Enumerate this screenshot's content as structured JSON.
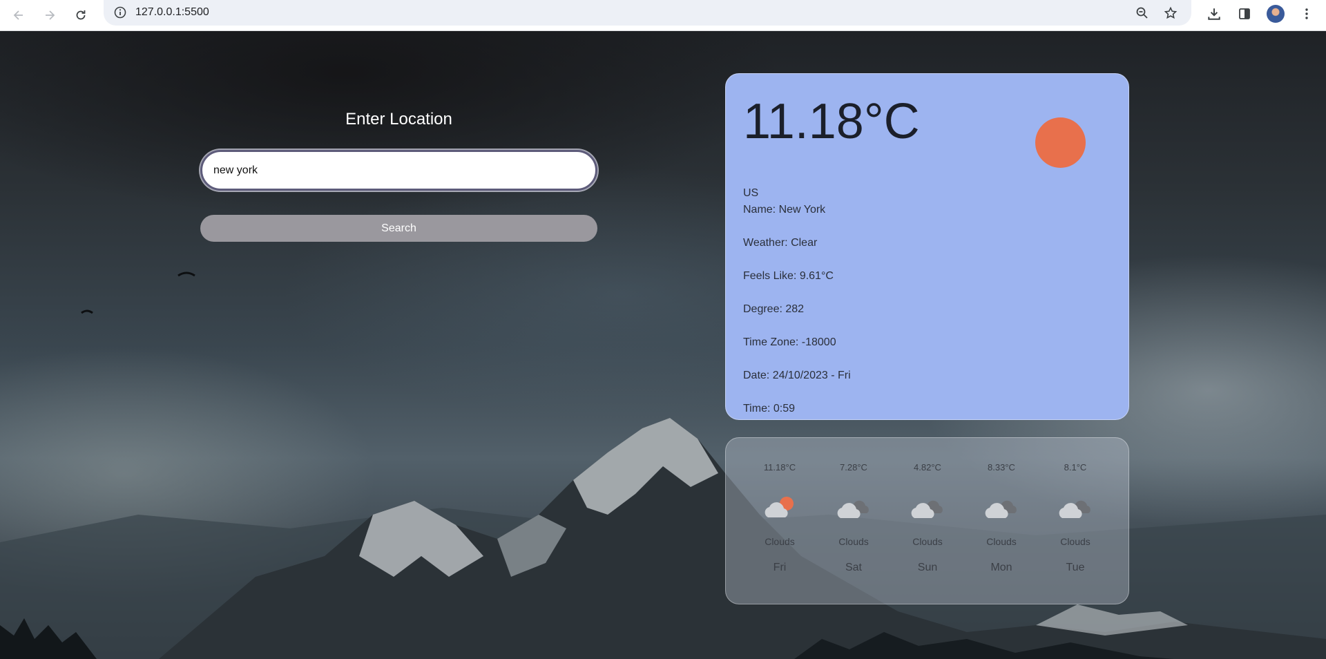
{
  "browser": {
    "url": "127.0.0.1:5500"
  },
  "search": {
    "title": "Enter Location",
    "value": "new york",
    "button_label": "Search"
  },
  "current": {
    "temperature": "11.18°C",
    "country": "US",
    "name": "Name: New York",
    "weather": "Weather: Clear",
    "feels_like": "Feels Like: 9.61°C",
    "degree": "Degree: 282",
    "timezone": "Time Zone: -18000",
    "date": "Date: 24/10/2023 - Fri",
    "time": "Time: 0:59",
    "icon": "sun-icon",
    "sun_color": "#e8704c",
    "card_color": "#9db4f0"
  },
  "forecast": [
    {
      "temp": "11.18°C",
      "desc": "Clouds",
      "day": "Fri",
      "icon": "partly-cloudy-icon"
    },
    {
      "temp": "7.28°C",
      "desc": "Clouds",
      "day": "Sat",
      "icon": "clouds-icon"
    },
    {
      "temp": "4.82°C",
      "desc": "Clouds",
      "day": "Sun",
      "icon": "clouds-icon"
    },
    {
      "temp": "8.33°C",
      "desc": "Clouds",
      "day": "Mon",
      "icon": "clouds-icon"
    },
    {
      "temp": "8.1°C",
      "desc": "Clouds",
      "day": "Tue",
      "icon": "clouds-icon"
    }
  ]
}
